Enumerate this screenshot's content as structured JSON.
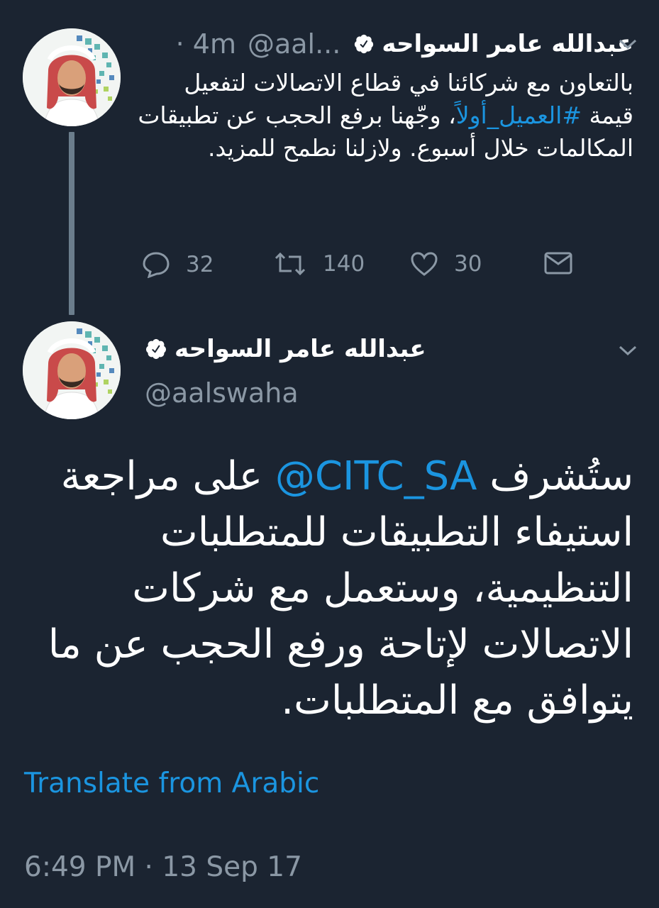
{
  "colors": {
    "background": "#1b2431",
    "accent": "#1b95e0",
    "muted": "#8b98a5",
    "verified": "#ffffff"
  },
  "reply_tweet": {
    "name": "عبدالله عامر السواحه",
    "handle": "@aal...",
    "time": "· 4m",
    "text_before_hashtag": "بالتعاون مع شركائنا في قطاع الاتصالات لتفعيل قيمة ",
    "hashtag": "#العميل_أولاً",
    "text_after_hashtag": "، وجّهنا برفع الحجب عن تطبيقات المكالمات خلال أسبوع. ولازلنا نطمح للمزيد.",
    "actions": {
      "replies": "32",
      "retweets": "140",
      "likes": "30"
    }
  },
  "main_tweet": {
    "name": "عبدالله عامر السواحه",
    "handle": "@aalswaha",
    "text_before_mention": "ستُشرف ",
    "mention": "@CITC_SA",
    "text_after_mention": " على مراجعة استيفاء التطبيقات للمتطلبات التنظيمية، وستعمل مع شركات الاتصالات لإتاحة ورفع الحجب عن ما يتوافق مع المتطلبات.",
    "translate_label": "Translate from Arabic",
    "timestamp": "6:49 PM · 13 Sep 17"
  },
  "icons": [
    "avatar",
    "verified-badge-icon",
    "chevron-down-icon",
    "reply-icon",
    "retweet-icon",
    "like-icon",
    "dm-icon"
  ]
}
